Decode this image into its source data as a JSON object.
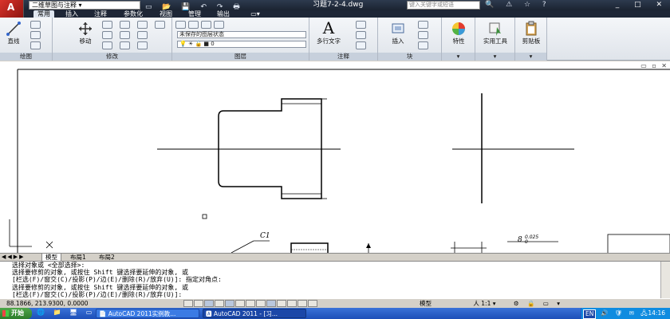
{
  "titlebar": {
    "workspace": "二维草图与注释",
    "document_title": "习题7-2-4.dwg",
    "search_placeholder": "键入关键字或短语"
  },
  "tabs": [
    "常用",
    "插入",
    "注释",
    "参数化",
    "视图",
    "管理",
    "输出"
  ],
  "ribbon": {
    "draw": {
      "label": "绘图",
      "line": "直线"
    },
    "modify": {
      "label": "修改",
      "move": "移动"
    },
    "layers": {
      "label": "图层",
      "state_combo": "未保存的图层状态",
      "layer_combo": "0"
    },
    "annotation": {
      "label": "注释",
      "mtext": "多行文字"
    },
    "block": {
      "label": "块",
      "insert": "插入"
    },
    "properties": {
      "label": "特性"
    },
    "utilities": {
      "label": "实用工具"
    },
    "clipboard": {
      "label": "剪贴板"
    }
  },
  "drawing": {
    "chamfer_label": "C1",
    "tolerance_base": "8",
    "tolerance_upper": "0.025",
    "tolerance_lower": "0"
  },
  "layout_tabs": [
    "模型",
    "布局1",
    "布局2"
  ],
  "command_lines": [
    "选择对象或 <全部选择>:",
    "选择要修剪的对象, 或按住 Shift 键选择要延伸的对象, 或",
    "[栏选(F)/窗交(C)/投影(P)/边(E)/删除(R)/放弃(U)]: 指定对角点:",
    "选择要修剪的对象, 或按住 Shift 键选择要延伸的对象, 或",
    "[栏选(F)/窗交(C)/投影(P)/边(E)/删除(R)/放弃(U)]:"
  ],
  "statusbar": {
    "coordinates": "88.1866, 213.9300, 0.0000",
    "model_label": "模型",
    "scale": "1:1",
    "time": "14:16"
  },
  "taskbar": {
    "start": "开始",
    "tasks": [
      "AutoCAD 2011实例教...",
      "AutoCAD 2011 - [习..."
    ],
    "lang": "EN"
  }
}
